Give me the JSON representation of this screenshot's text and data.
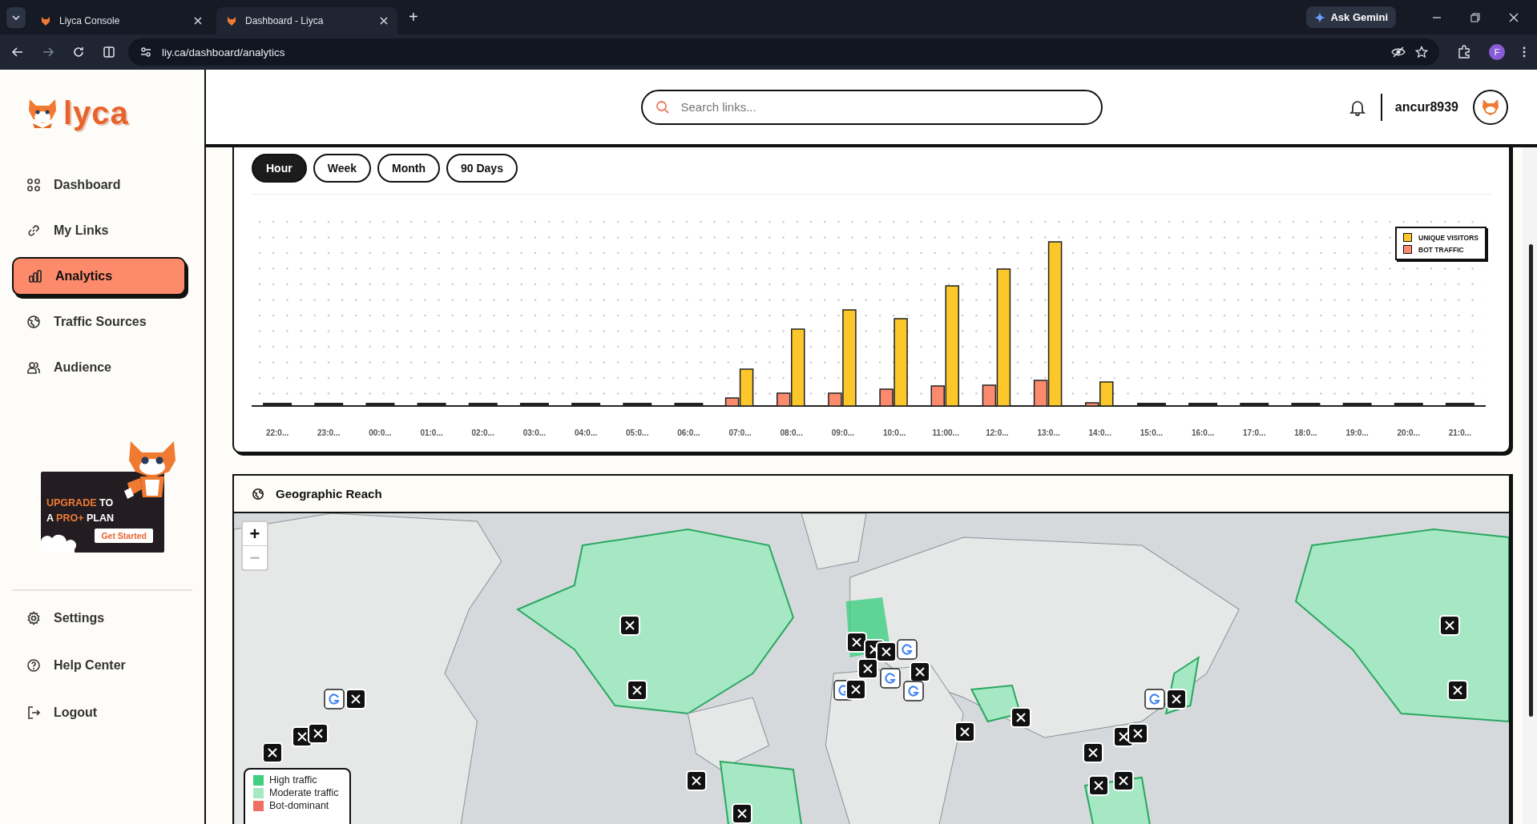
{
  "browser": {
    "tabs": [
      {
        "title": "Liyca Console",
        "selected": false
      },
      {
        "title": "Dashboard - Liyca",
        "selected": true
      }
    ],
    "new_tab": "+",
    "ask_gemini": "Ask Gemini",
    "url": "liy.ca/dashboard/analytics",
    "profile": "F"
  },
  "sidebar": {
    "logo": "lyca",
    "items": [
      {
        "label": "Dashboard",
        "selected": false
      },
      {
        "label": "My Links",
        "selected": false
      },
      {
        "label": "Analytics",
        "selected": true
      },
      {
        "label": "Traffic Sources",
        "selected": false
      },
      {
        "label": "Audience",
        "selected": false
      }
    ],
    "promo": {
      "line_1": "**UPGRADE** TO",
      "line_2": "A **PRO+** PLAN",
      "button": "Get Started"
    },
    "bottom_items": [
      {
        "label": "Settings"
      },
      {
        "label": "Help Center"
      },
      {
        "label": "Logout"
      }
    ]
  },
  "header": {
    "search": {
      "placeholder": "Search links..."
    },
    "username": "ancur8939"
  },
  "traffic_chart": {
    "ranges": [
      {
        "label": "Hour",
        "selected": true
      },
      {
        "label": "Week",
        "selected": false
      },
      {
        "label": "Month",
        "selected": false
      },
      {
        "label": "90 Days",
        "selected": false
      }
    ],
    "legend": [
      {
        "label": "UNIQUE VISITORS",
        "color": "#fcc72a"
      },
      {
        "label": "BOT TRAFFIC",
        "color": "#fb8a6e"
      }
    ],
    "x_labels": [
      "22:0...",
      "23:0...",
      "00:0...",
      "01:0...",
      "02:0...",
      "03:0...",
      "04:0...",
      "05:0...",
      "06:0...",
      "07:0...",
      "08:0...",
      "09:0...",
      "10:0...",
      "11:00...",
      "12:0...",
      "13:0...",
      "14:0...",
      "15:0...",
      "16:0...",
      "17:0...",
      "18:0...",
      "19:0...",
      "20:0...",
      "21:0..."
    ]
  },
  "geographic_reach": {
    "title": "Geographic Reach",
    "zoom_in": "+",
    "zoom_out": "−",
    "legend": [
      {
        "label": "High traffic",
        "color": "#3ecf7f"
      },
      {
        "label": "Moderate traffic",
        "color": "#a6e8c4"
      },
      {
        "label": "Bot-dominant",
        "color": "#ee6f62"
      }
    ]
  }
}
